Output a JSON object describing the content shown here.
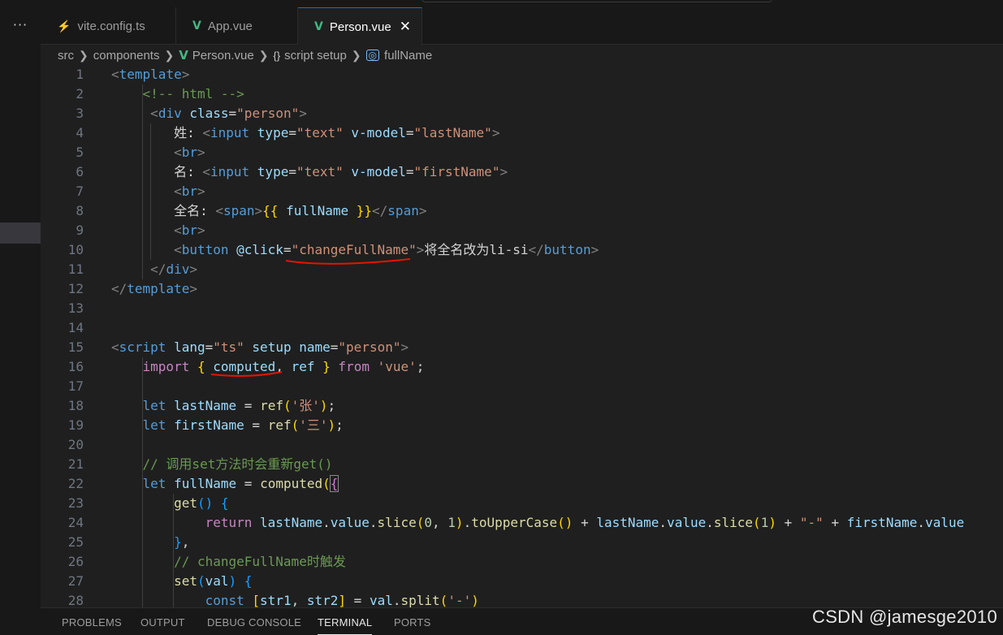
{
  "tabs": [
    {
      "icon": "⚡",
      "label": "vite.config.ts",
      "active": false
    },
    {
      "icon": "V",
      "label": "App.vue",
      "active": false
    },
    {
      "icon": "V",
      "label": "Person.vue",
      "active": true,
      "close": "✕"
    }
  ],
  "activity": {
    "more": "···"
  },
  "breadcrumb": {
    "src": "src",
    "components": "components",
    "file": "Person.vue",
    "scope_icon": "{}",
    "scope": "script setup",
    "symbol": "fullName"
  },
  "line_numbers": [
    "1",
    "2",
    "3",
    "4",
    "5",
    "6",
    "7",
    "8",
    "9",
    "10",
    "11",
    "12",
    "13",
    "14",
    "15",
    "16",
    "17",
    "18",
    "19",
    "20",
    "21",
    "22",
    "23",
    "24",
    "25",
    "26",
    "27",
    "28"
  ],
  "code": {
    "l1": {
      "open": "<",
      "tag": "template",
      "close": ">"
    },
    "l2": {
      "comment": "<!-- html -->"
    },
    "l3": {
      "open": "<",
      "tag": "div",
      "attr": "class",
      "eq": "=",
      "val": "\"person\"",
      "close": ">"
    },
    "l4": {
      "text": "姓:",
      "open": "<",
      "tag": "input",
      "a1": "type",
      "v1": "\"text\"",
      "a2": "v-model",
      "v2": "\"lastName\"",
      "close": ">"
    },
    "l5": {
      "open": "<",
      "tag": "br",
      "close": ">"
    },
    "l6": {
      "text": "名:",
      "open": "<",
      "tag": "input",
      "a1": "type",
      "v1": "\"text\"",
      "a2": "v-model",
      "v2": "\"firstName\"",
      "close": ">"
    },
    "l7": {
      "open": "<",
      "tag": "br",
      "close": ">"
    },
    "l8": {
      "text": "全名:",
      "open": "<",
      "tag": "span",
      "close": ">",
      "m_open": "{{",
      "expr": "fullName",
      "m_close": "}}",
      "end_open": "</",
      "end_tag": "span",
      "end_close": ">"
    },
    "l9": {
      "open": "<",
      "tag": "br",
      "close": ">"
    },
    "l10": {
      "open": "<",
      "tag": "button",
      "attr": "@click",
      "eq": "=",
      "val": "\"changeFullName\"",
      "close": ">",
      "text": "将全名改为li-si",
      "end_open": "</",
      "end_tag": "button",
      "end_close": ">"
    },
    "l11": {
      "open": "</",
      "tag": "div",
      "close": ">"
    },
    "l12": {
      "open": "</",
      "tag": "template",
      "close": ">"
    },
    "l15": {
      "open": "<",
      "tag": "script",
      "a1": "lang",
      "v1": "\"ts\"",
      "a2": "setup",
      "a3": "name",
      "v3": "\"person\"",
      "close": ">"
    },
    "l16": {
      "kw": "import",
      "b_open": "{",
      "n1": "computed",
      "comma": ",",
      "n2": "ref",
      "b_close": "}",
      "from": "from",
      "mod": "'vue'",
      "semi": ";"
    },
    "l18": {
      "kw": "let",
      "name": "lastName",
      "eq": "=",
      "fn": "ref",
      "p_open": "(",
      "arg": "'张'",
      "p_close": ")",
      "semi": ";"
    },
    "l19": {
      "kw": "let",
      "name": "firstName",
      "eq": "=",
      "fn": "ref",
      "p_open": "(",
      "arg": "'三'",
      "p_close": ")",
      "semi": ";"
    },
    "l21": {
      "comment": "// 调用set方法时会重新get()"
    },
    "l22": {
      "kw": "let",
      "name": "fullName",
      "eq": "=",
      "fn": "computed",
      "p_open": "(",
      "b_open": "{"
    },
    "l23": {
      "fn": "get",
      "parens": "()",
      "b_open": "{"
    },
    "l24": {
      "kw": "return",
      "v1": "lastName",
      "d1": ".",
      "p1": "value",
      "d2": ".",
      "f1": "slice",
      "po1": "(",
      "n1": "0",
      "c1": ",",
      "n2": "1",
      "pc1": ")",
      "d3": ".",
      "f2": "toUpperCase",
      "pp2": "()",
      "plus1": "+",
      "v2": "lastName",
      "d4": ".",
      "p2": "value",
      "d5": ".",
      "f3": "slice",
      "po3": "(",
      "n3": "1",
      "pc3": ")",
      "plus2": "+",
      "s1": "\"-\"",
      "plus3": "+",
      "v3": "firstName",
      "d6": ".",
      "p3": "value"
    },
    "l25": {
      "b_close": "}",
      "comma": ","
    },
    "l26": {
      "comment": "// changeFullName时触发"
    },
    "l27": {
      "fn": "set",
      "p_open": "(",
      "arg": "val",
      "p_close": ")",
      "b_open": "{"
    },
    "l28": {
      "kw": "const",
      "br_open": "[",
      "a": "str1",
      "comma": ",",
      "b": "str2",
      "br_close": "]",
      "eq": "=",
      "v": "val",
      "dot": ".",
      "fn": "split",
      "p_open": "(",
      "arg": "'-'",
      "p_close": ")"
    }
  },
  "panel": {
    "tabs": [
      "PROBLEMS",
      "OUTPUT",
      "DEBUG CONSOLE",
      "TERMINAL",
      "PORTS"
    ],
    "active": "TERMINAL"
  },
  "watermark": "CSDN @jamesge2010",
  "colors": {
    "accent": "#0078d4",
    "annotation": "#e51400",
    "vue": "#41b883"
  }
}
